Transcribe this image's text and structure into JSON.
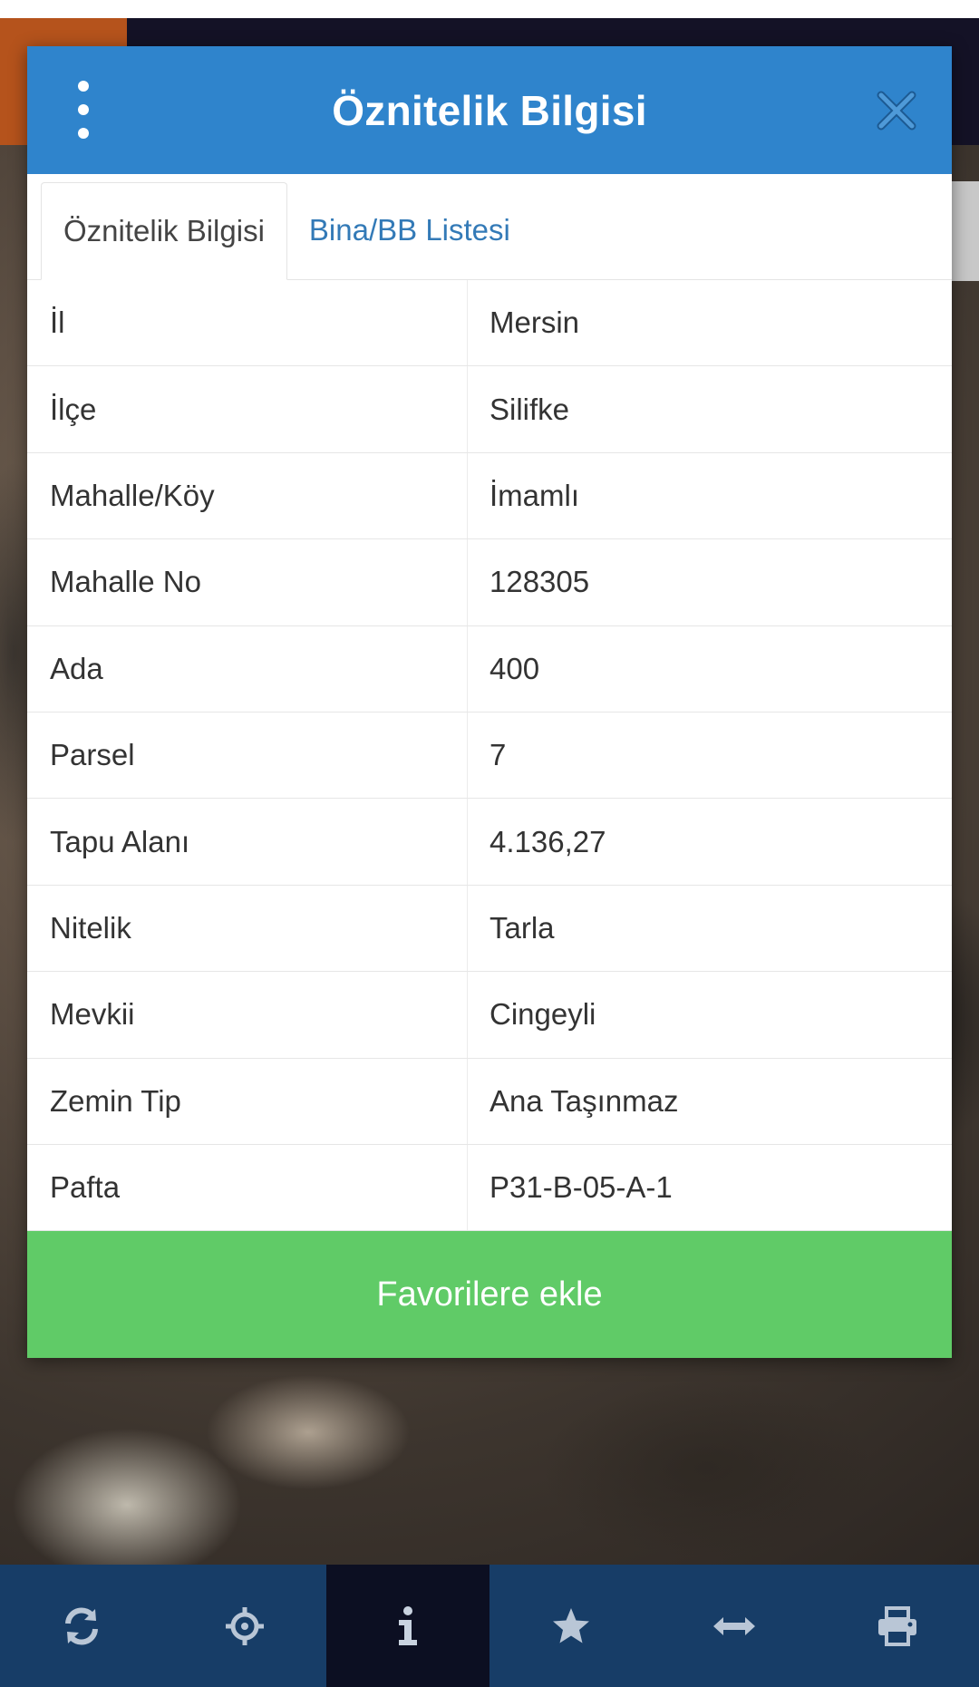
{
  "dialog": {
    "title": "Öznitelik Bilgisi",
    "tabs": [
      {
        "label": "Öznitelik Bilgisi",
        "active": true
      },
      {
        "label": "Bina/BB Listesi",
        "active": false
      }
    ],
    "rows": [
      {
        "key": "İl",
        "value": "Mersin"
      },
      {
        "key": "İlçe",
        "value": "Silifke"
      },
      {
        "key": "Mahalle/Köy",
        "value": "İmamlı"
      },
      {
        "key": "Mahalle No",
        "value": "128305"
      },
      {
        "key": "Ada",
        "value": "400"
      },
      {
        "key": "Parsel",
        "value": "7"
      },
      {
        "key": "Tapu Alanı",
        "value": "4.136,27"
      },
      {
        "key": "Nitelik",
        "value": "Tarla"
      },
      {
        "key": "Mevkii",
        "value": "Cingeyli"
      },
      {
        "key": "Zemin Tip",
        "value": "Ana Taşınmaz"
      },
      {
        "key": "Pafta",
        "value": "P31-B-05-A-1"
      }
    ],
    "favorite_button_label": "Favorilere ekle"
  },
  "toolbar": {
    "items": [
      {
        "icon": "refresh-icon",
        "active": false
      },
      {
        "icon": "crosshair-icon",
        "active": false
      },
      {
        "icon": "info-icon",
        "active": true
      },
      {
        "icon": "star-icon",
        "active": false
      },
      {
        "icon": "measure-icon",
        "active": false
      },
      {
        "icon": "print-icon",
        "active": false
      }
    ]
  },
  "colors": {
    "header": "#2f84cc",
    "favorite_button": "#60cb67",
    "toolbar": "#173d67",
    "toolbar_active": "#0c0f22",
    "tab_link": "#337ab7"
  }
}
